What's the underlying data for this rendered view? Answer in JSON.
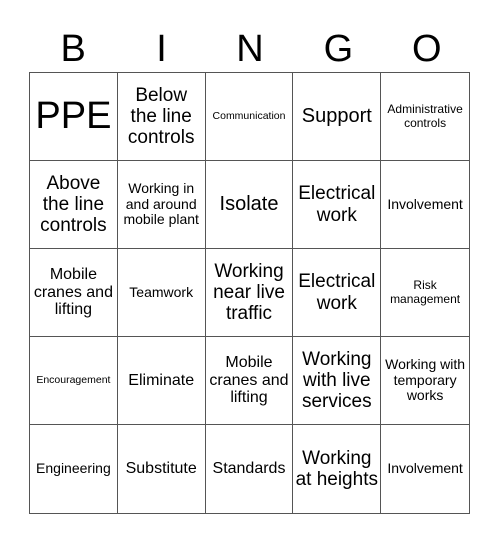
{
  "header": [
    "B",
    "I",
    "N",
    "G",
    "O"
  ],
  "cells": [
    {
      "text": "PPE",
      "size": "s-xxl"
    },
    {
      "text": "Below the line controls",
      "size": "s-l"
    },
    {
      "text": "Communication",
      "size": "s-xxs"
    },
    {
      "text": "Support",
      "size": "s-xl"
    },
    {
      "text": "Administrative controls",
      "size": "s-xs"
    },
    {
      "text": "Above the line controls",
      "size": "s-l"
    },
    {
      "text": "Working in and around mobile plant",
      "size": "s-sm"
    },
    {
      "text": "Isolate",
      "size": "s-xl"
    },
    {
      "text": "Electrical work",
      "size": "s-l"
    },
    {
      "text": "Involvement",
      "size": "s-sm"
    },
    {
      "text": "Mobile cranes and lifting",
      "size": "s-m"
    },
    {
      "text": "Teamwork",
      "size": "s-sm"
    },
    {
      "text": "Working near live traffic",
      "size": "s-l"
    },
    {
      "text": "Electrical work",
      "size": "s-l"
    },
    {
      "text": "Risk management",
      "size": "s-xs"
    },
    {
      "text": "Encouragement",
      "size": "s-xxs"
    },
    {
      "text": "Eliminate",
      "size": "s-m"
    },
    {
      "text": "Mobile cranes and lifting",
      "size": "s-m"
    },
    {
      "text": "Working with live services",
      "size": "s-l"
    },
    {
      "text": "Working with temporary works",
      "size": "s-sm"
    },
    {
      "text": "Engineering",
      "size": "s-sm"
    },
    {
      "text": "Substitute",
      "size": "s-m"
    },
    {
      "text": "Standards",
      "size": "s-m"
    },
    {
      "text": "Working at heights",
      "size": "s-l"
    },
    {
      "text": "Involvement",
      "size": "s-sm"
    }
  ]
}
